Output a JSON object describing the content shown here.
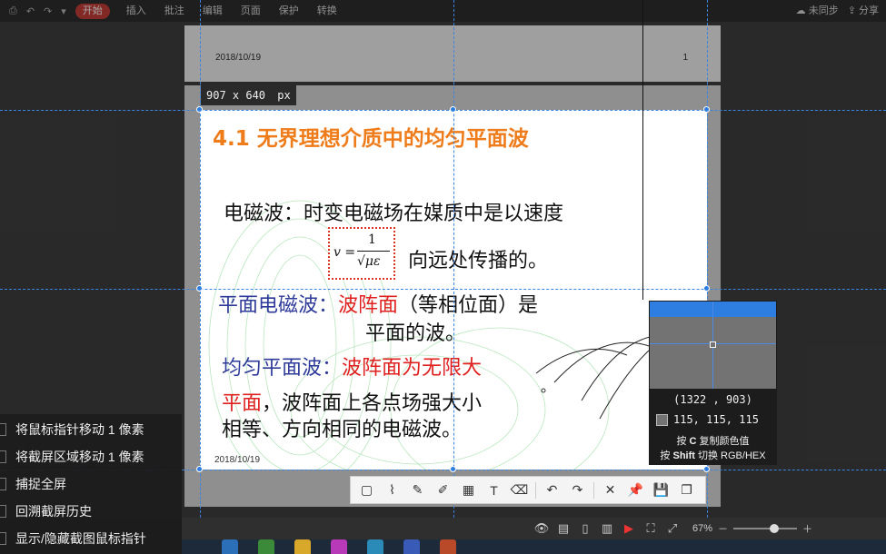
{
  "menubar": {
    "quick_icons": [
      "print-icon",
      "undo-icon",
      "redo-icon",
      "dropdown-icon"
    ],
    "tabs": [
      "开始",
      "插入",
      "批注",
      "编辑",
      "页面",
      "保护",
      "转换"
    ],
    "sync_label": "未同步",
    "share_label": "分享"
  },
  "page1": {
    "date": "2018/10/19",
    "page_number": "1"
  },
  "capture": {
    "size_label": "907 x 640",
    "size_unit": "px"
  },
  "slide": {
    "title": "4.1  无界理想介质中的均匀平面波",
    "line1": "电磁波：时变电磁场在媒质中是以速度",
    "formula_lhs": "v =",
    "formula_num": "1",
    "formula_den": "√με",
    "line2": "向远处传播的。",
    "plane_label": "平面电磁波：",
    "plane_red": "波阵面",
    "plane_rest": "（等相位面）是",
    "plane_line2": "平面的波。",
    "uniform_label": "均匀平面波：",
    "uniform_red": "波阵面为无限大",
    "flat_red": "平面",
    "flat_rest": "，波阵面上各点场强大小",
    "last_line": "相等、方向相同的电磁波。",
    "date": "2018/10/19"
  },
  "magnifier": {
    "coord": "(1322 , 903)",
    "rgb": "115, 115, 115",
    "swatch_color": "#737373",
    "hint_copy_pre": "按",
    "hint_copy_key": "C",
    "hint_copy_post": "复制颜色值",
    "hint_switch_pre": "按",
    "hint_switch_key": "Shift",
    "hint_switch_post": "切换 RGB/HEX"
  },
  "capture_toolbar": {
    "tools": [
      "rectangle-icon",
      "polyline-icon",
      "pen-icon",
      "marker-icon",
      "mosaic-icon",
      "text-icon",
      "eraser-icon",
      "undo-icon",
      "redo-icon",
      "close-icon",
      "pin-icon",
      "save-icon",
      "copy-icon"
    ]
  },
  "side_menu": {
    "items": [
      "将鼠标指针移动 1 像素",
      "将截屏区域移动 1 像素",
      "捕捉全屏",
      "回溯截屏历史",
      "显示/隐藏截图鼠标指针"
    ]
  },
  "statusbar": {
    "zoom": "67%",
    "zoom_fraction": 0.67
  },
  "colors": {
    "accent": "#2e7de0",
    "title_orange": "#ef7c1a",
    "slide_blue": "#2e3a9a",
    "slide_red": "#e01f1f",
    "start_tab": "#c8403a"
  }
}
